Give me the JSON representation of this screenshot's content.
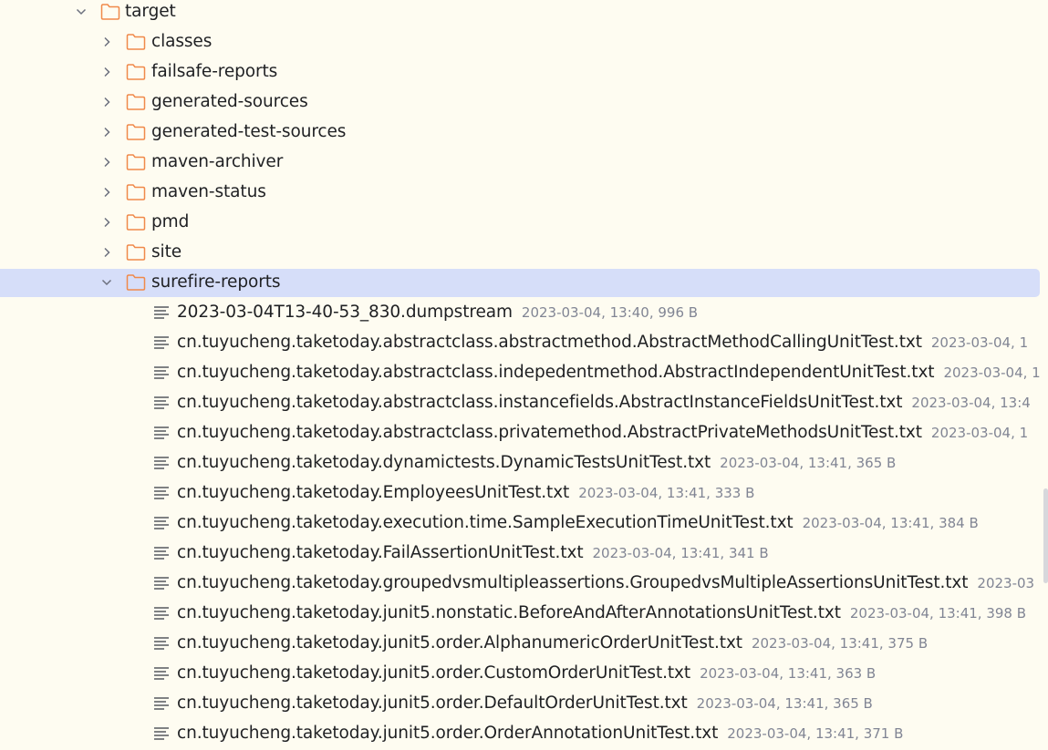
{
  "tree": {
    "root": {
      "name": "target",
      "expanded": true
    },
    "folders": [
      {
        "name": "classes"
      },
      {
        "name": "failsafe-reports"
      },
      {
        "name": "generated-sources"
      },
      {
        "name": "generated-test-sources"
      },
      {
        "name": "maven-archiver"
      },
      {
        "name": "maven-status"
      },
      {
        "name": "pmd"
      },
      {
        "name": "site"
      }
    ],
    "open_folder": {
      "name": "surefire-reports",
      "expanded": true,
      "selected": true
    },
    "files": [
      {
        "name": "2023-03-04T13-40-53_830.dumpstream",
        "meta": "2023-03-04, 13:40, 996 B"
      },
      {
        "name": "cn.tuyucheng.taketoday.abstractclass.abstractmethod.AbstractMethodCallingUnitTest.txt",
        "meta": "2023-03-04, 1"
      },
      {
        "name": "cn.tuyucheng.taketoday.abstractclass.indepedentmethod.AbstractIndependentUnitTest.txt",
        "meta": "2023-03-04, 1"
      },
      {
        "name": "cn.tuyucheng.taketoday.abstractclass.instancefields.AbstractInstanceFieldsUnitTest.txt",
        "meta": "2023-03-04, 13:4"
      },
      {
        "name": "cn.tuyucheng.taketoday.abstractclass.privatemethod.AbstractPrivateMethodsUnitTest.txt",
        "meta": "2023-03-04, 1"
      },
      {
        "name": "cn.tuyucheng.taketoday.dynamictests.DynamicTestsUnitTest.txt",
        "meta": "2023-03-04, 13:41, 365 B"
      },
      {
        "name": "cn.tuyucheng.taketoday.EmployeesUnitTest.txt",
        "meta": "2023-03-04, 13:41, 333 B"
      },
      {
        "name": "cn.tuyucheng.taketoday.execution.time.SampleExecutionTimeUnitTest.txt",
        "meta": "2023-03-04, 13:41, 384 B"
      },
      {
        "name": "cn.tuyucheng.taketoday.FailAssertionUnitTest.txt",
        "meta": "2023-03-04, 13:41, 341 B"
      },
      {
        "name": "cn.tuyucheng.taketoday.groupedvsmultipleassertions.GroupedvsMultipleAssertionsUnitTest.txt",
        "meta": "2023-03"
      },
      {
        "name": "cn.tuyucheng.taketoday.junit5.nonstatic.BeforeAndAfterAnnotationsUnitTest.txt",
        "meta": "2023-03-04, 13:41, 398 B"
      },
      {
        "name": "cn.tuyucheng.taketoday.junit5.order.AlphanumericOrderUnitTest.txt",
        "meta": "2023-03-04, 13:41, 375 B"
      },
      {
        "name": "cn.tuyucheng.taketoday.junit5.order.CustomOrderUnitTest.txt",
        "meta": "2023-03-04, 13:41, 363 B"
      },
      {
        "name": "cn.tuyucheng.taketoday.junit5.order.DefaultOrderUnitTest.txt",
        "meta": "2023-03-04, 13:41, 365 B"
      },
      {
        "name": "cn.tuyucheng.taketoday.junit5.order.OrderAnnotationUnitTest.txt",
        "meta": "2023-03-04, 13:41, 371 B"
      }
    ]
  },
  "colors": {
    "background": "#fefcf1",
    "selection": "#d6def9",
    "folder_stroke": "#f0894a",
    "meta_text": "#818594"
  },
  "icons": {
    "folder": "folder-icon",
    "file": "text-file-icon",
    "expanded": "chevron-down-icon",
    "collapsed": "chevron-right-icon"
  }
}
